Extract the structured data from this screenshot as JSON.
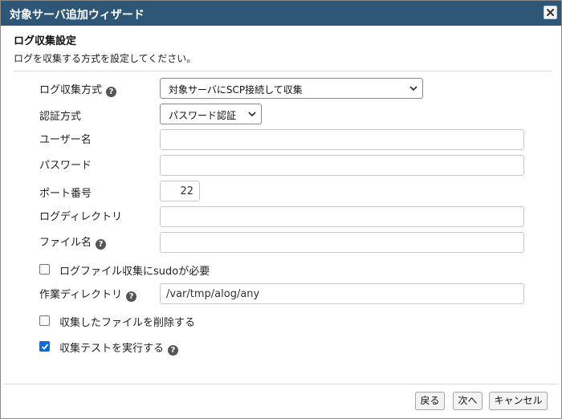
{
  "dialog": {
    "title": "対象サーバ追加ウィザード",
    "close_icon": "close-icon"
  },
  "section": {
    "title": "ログ収集設定",
    "description": "ログを収集する方式を設定してください。"
  },
  "form": {
    "collection_method": {
      "label": "ログ収集方式",
      "value": "対象サーバにSCP接続して収集"
    },
    "auth_method": {
      "label": "認証方式",
      "value": "パスワード認証"
    },
    "username": {
      "label": "ユーザー名",
      "value": ""
    },
    "password": {
      "label": "パスワード",
      "value": ""
    },
    "port": {
      "label": "ポート番号",
      "value": "22"
    },
    "log_directory": {
      "label": "ログディレクトリ",
      "value": ""
    },
    "file_name": {
      "label": "ファイル名",
      "value": ""
    },
    "sudo_required": {
      "label": "ログファイル収集にsudoが必要",
      "checked": false
    },
    "work_directory": {
      "label": "作業ディレクトリ",
      "value": "/var/tmp/alog/any"
    },
    "delete_collected": {
      "label": "収集したファイルを削除する",
      "checked": false
    },
    "run_test": {
      "label": "収集テストを実行する",
      "checked": true
    }
  },
  "help_icon_glyph": "?",
  "footer": {
    "back_label": "戻る",
    "next_label": "次へ",
    "cancel_label": "キャンセル"
  }
}
